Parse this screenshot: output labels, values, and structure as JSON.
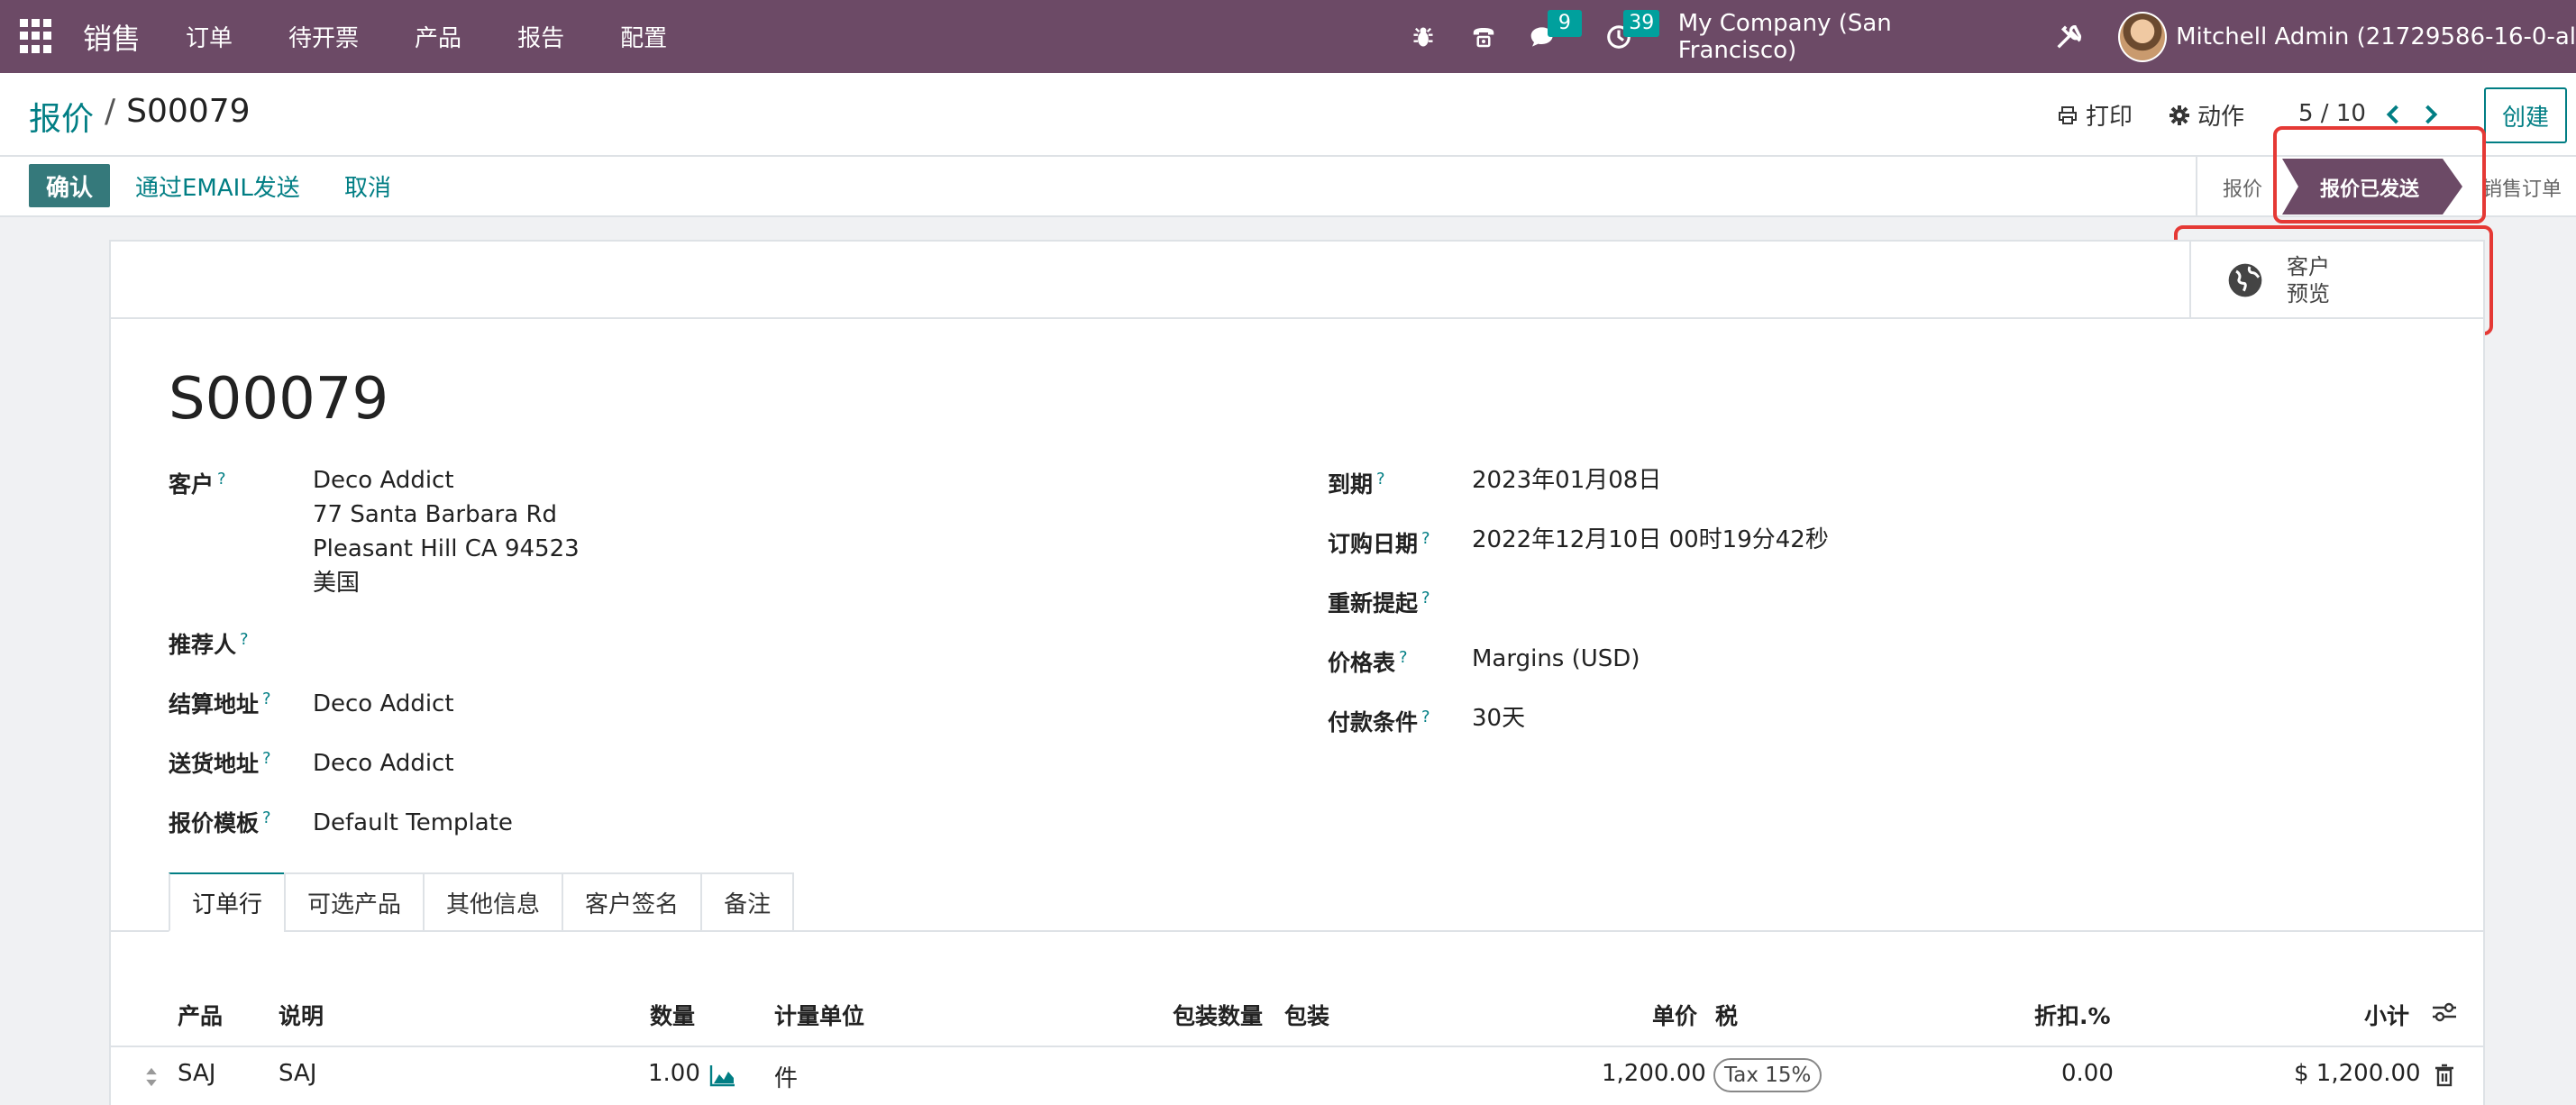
{
  "navbar": {
    "app_name": "销售",
    "menu": [
      "订单",
      "待开票",
      "产品",
      "报告",
      "配置"
    ],
    "messages_count": "9",
    "activities_count": "39",
    "company": "My Company (San Francisco)",
    "user": "Mitchell Admin (21729586-16-0-al"
  },
  "control": {
    "breadcrumb_parent": "报价",
    "breadcrumb_sep": "/",
    "breadcrumb_current": "S00079",
    "print_label": "打印",
    "action_label": "动作",
    "pager": "5 / 10",
    "create_label": "创建"
  },
  "statusbar": {
    "confirm_label": "确认",
    "send_email_label": "通过EMAIL发送",
    "cancel_label": "取消",
    "stages": [
      "报价",
      "报价已发送",
      "销售订单"
    ],
    "active_stage": "报价已发送"
  },
  "smart_button": {
    "line1": "客户",
    "line2": "预览"
  },
  "record": {
    "title": "S00079",
    "customer_label": "客户",
    "customer_lines": [
      "Deco Addict",
      "77 Santa Barbara Rd",
      "Pleasant Hill CA 94523",
      "美国"
    ],
    "referrer_label": "推荐人",
    "invoice_address_label": "结算地址",
    "invoice_address": "Deco Addict",
    "delivery_address_label": "送货地址",
    "delivery_address": "Deco Addict",
    "template_label": "报价模板",
    "template": "Default Template",
    "expiry_label": "到期",
    "expiry": "2023年01月08日",
    "order_date_label": "订购日期",
    "order_date": "2022年12月10日 00时19分42秒",
    "reminder_label": "重新提起",
    "pricelist_label": "价格表",
    "pricelist": "Margins (USD)",
    "payment_terms_label": "付款条件",
    "payment_terms": "30天",
    "help_mark": "?"
  },
  "tabs": [
    "订单行",
    "可选产品",
    "其他信息",
    "客户签名",
    "备注"
  ],
  "order_lines": {
    "headers": {
      "product": "产品",
      "description": "说明",
      "quantity": "数量",
      "uom": "计量单位",
      "packaging_qty": "包装数量",
      "packaging": "包装",
      "unit_price": "单价",
      "taxes": "税",
      "discount": "折扣.%",
      "subtotal": "小计"
    },
    "rows": [
      {
        "product": "SAJ",
        "description": "SAJ",
        "quantity": "1.00",
        "uom": "件",
        "unit_price": "1,200.00",
        "tax": "Tax 15%",
        "discount": "0.00",
        "subtotal": "$ 1,200.00"
      }
    ]
  }
}
